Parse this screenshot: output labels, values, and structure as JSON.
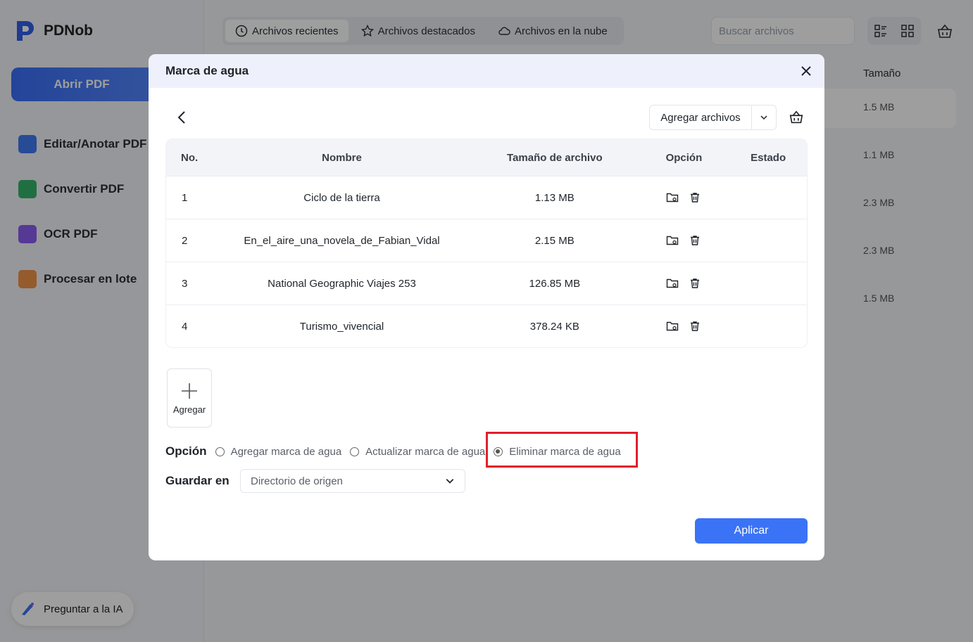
{
  "app": {
    "name": "PDNob",
    "open_pdf": "Abrir PDF",
    "nav": [
      "Editar/Anotar PDF",
      "Convertir PDF",
      "OCR PDF",
      "Procesar en lote"
    ],
    "ask_ai": "Preguntar a la IA"
  },
  "topbar": {
    "tabs": [
      "Archivos recientes",
      "Archivos destacados",
      "Archivos en la nube"
    ],
    "search_placeholder": "Buscar archivos"
  },
  "background_list": {
    "size_header": "Tamaño",
    "sizes": [
      "1.5 MB",
      "1.1 MB",
      "2.3 MB",
      "2.3 MB",
      "1.5 MB"
    ]
  },
  "dialog": {
    "title": "Marca de agua",
    "add_files": "Agregar archivos",
    "table": {
      "headers": [
        "No.",
        "Nombre",
        "Tamaño de archivo",
        "Opción",
        "Estado"
      ],
      "rows": [
        {
          "no": "1",
          "name": "Ciclo de la tierra",
          "size": "1.13 MB",
          "status": ""
        },
        {
          "no": "2",
          "name": "En_el_aire_una_novela_de_Fabian_Vidal",
          "size": "2.15 MB",
          "status": ""
        },
        {
          "no": "3",
          "name": "National Geographic Viajes 253",
          "size": "126.85 MB",
          "status": ""
        },
        {
          "no": "4",
          "name": "Turismo_vivencial",
          "size": "378.24 KB",
          "status": ""
        }
      ]
    },
    "add_tile": "Agregar",
    "option_label": "Opción",
    "options": [
      "Agregar marca de agua",
      "Actualizar marca de agua",
      "Eliminar marca de agua"
    ],
    "selected_option": "Eliminar marca de agua",
    "save_label": "Guardar en",
    "save_value": "Directorio de origen",
    "apply": "Aplicar"
  },
  "colors": {
    "accent": "#3b73f6",
    "highlight": "#e0202b"
  }
}
